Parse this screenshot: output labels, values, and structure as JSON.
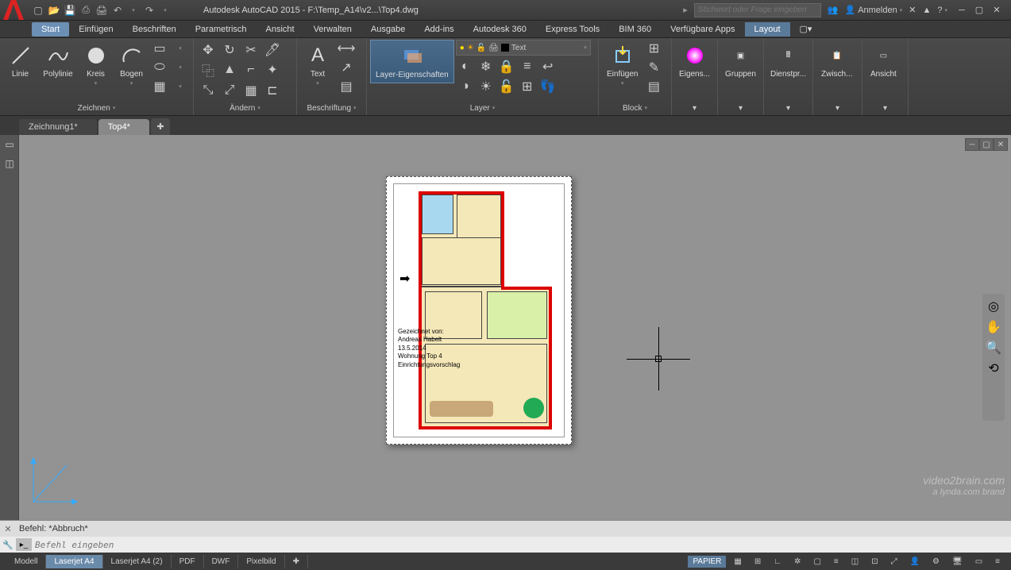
{
  "title": "Autodesk AutoCAD 2015 - F:\\Temp_A14\\v2...\\Top4.dwg",
  "search_placeholder": "Stichwort oder Frage eingeben",
  "signin": "Anmelden",
  "tabs": [
    "Start",
    "Einfügen",
    "Beschriften",
    "Parametrisch",
    "Ansicht",
    "Verwalten",
    "Ausgabe",
    "Add-ins",
    "Autodesk 360",
    "Express Tools",
    "BIM 360",
    "Verfügbare Apps",
    "Layout"
  ],
  "active_tab": 0,
  "highlight_tab": 12,
  "panels": {
    "draw": {
      "label": "Zeichnen",
      "items": [
        "Linie",
        "Polylinie",
        "Kreis",
        "Bogen"
      ]
    },
    "modify": {
      "label": "Ändern"
    },
    "annotation": {
      "label": "Beschriftung",
      "text": "Text"
    },
    "layers": {
      "label": "Layer",
      "btn": "Layer-Eigenschaften",
      "combo": "Text"
    },
    "block": {
      "label": "Block",
      "btn": "Einfügen"
    },
    "props": {
      "label": "Eigens..."
    },
    "groups": {
      "label": "Gruppen"
    },
    "utilities": {
      "label": "Dienstpr..."
    },
    "clipboard": {
      "label": "Zwisch..."
    },
    "view": {
      "label": "Ansicht"
    }
  },
  "file_tabs": [
    "Zeichnung1*",
    "Top4*"
  ],
  "active_file": 1,
  "drawing_notes": [
    "Gezeichnet von:",
    "Andreas Habelt",
    "13.5.2014",
    "Wohnung Top 4",
    "Einrichtungsvorschlag"
  ],
  "cmd_history": "Befehl: *Abbruch*",
  "cmd_placeholder": "Befehl eingeben",
  "layout_tabs": [
    "Modell",
    "Laserjet A4",
    "Laserjet A4 (2)",
    "PDF",
    "DWF",
    "Pixelbild"
  ],
  "active_layout": 1,
  "status_paper": "PAPIER",
  "watermark1": "video2brain.com",
  "watermark2": "a lynda.com brand"
}
